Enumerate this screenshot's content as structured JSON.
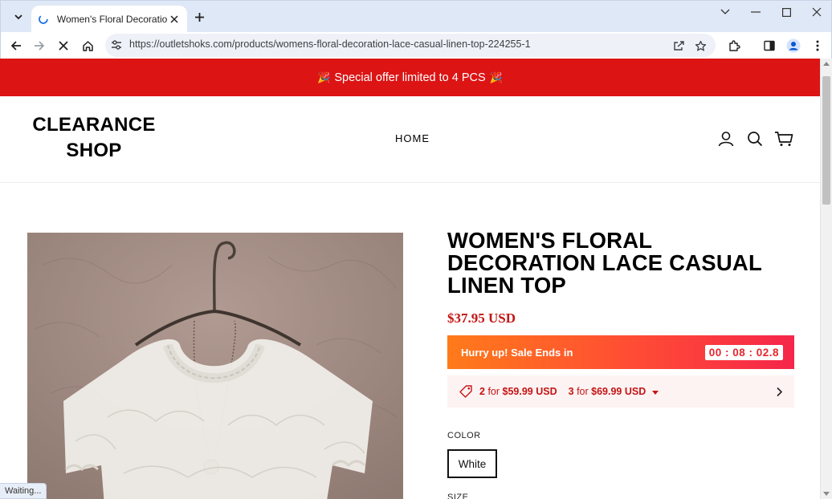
{
  "browser": {
    "tab_title": "Women's Floral Decoration Lace Casual Linen Top",
    "url": "https://outletshoks.com/products/womens-floral-decoration-lace-casual-linen-top-224255-1",
    "status_text": "Waiting..."
  },
  "promo": {
    "emoji": "🎉",
    "text": "Special offer limited to 4 PCS"
  },
  "header": {
    "logo_line1": "CLEARANCE",
    "logo_line2": "SHOP",
    "nav_home": "HOME"
  },
  "product": {
    "title": "WOMEN'S FLORAL DECORATION LACE CASUAL LINEN TOP",
    "price": "$37.95 USD",
    "timer_label": "Hurry up! Sale Ends in",
    "timer_value": "00 : 08 : 02.8",
    "bundles": [
      {
        "qty": "2",
        "word": "for",
        "price": "$59.99 USD"
      },
      {
        "qty": "3",
        "word": "for",
        "price": "$69.99 USD"
      }
    ],
    "color_label": "COLOR",
    "color_value": "White",
    "size_label": "SIZE"
  },
  "colors": {
    "promo_red": "#dc1414",
    "price_red": "#c41414",
    "timer_start": "#ff7a1a",
    "timer_end": "#f5264a"
  }
}
